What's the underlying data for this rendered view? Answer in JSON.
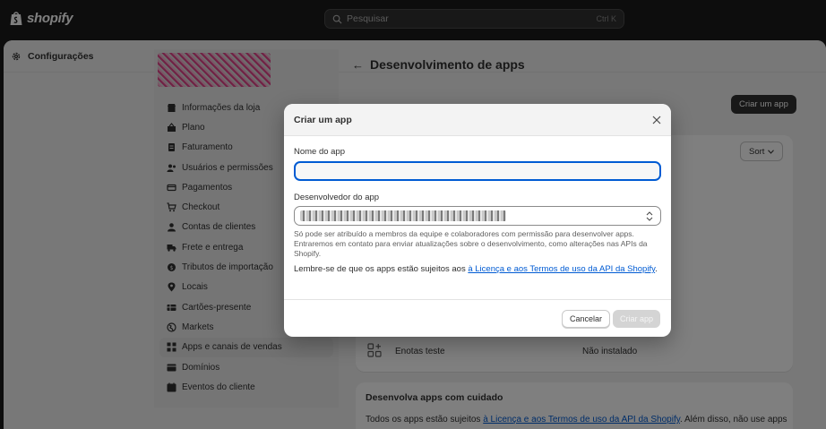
{
  "topbar": {
    "logo_text": "shopify",
    "search_placeholder": "Pesquisar",
    "search_shortcut": "Ctrl K"
  },
  "settings": {
    "title": "Configurações"
  },
  "sidebar": {
    "items": [
      {
        "label": "Informações da loja",
        "icon": "store-icon"
      },
      {
        "label": "Plano",
        "icon": "plan-icon"
      },
      {
        "label": "Faturamento",
        "icon": "billing-icon"
      },
      {
        "label": "Usuários e permissões",
        "icon": "users-icon"
      },
      {
        "label": "Pagamentos",
        "icon": "payments-icon"
      },
      {
        "label": "Checkout",
        "icon": "cart-icon"
      },
      {
        "label": "Contas de clientes",
        "icon": "customer-icon"
      },
      {
        "label": "Frete e entrega",
        "icon": "truck-icon"
      },
      {
        "label": "Tributos de importação",
        "icon": "duties-icon"
      },
      {
        "label": "Locais",
        "icon": "location-icon"
      },
      {
        "label": "Cartões-presente",
        "icon": "gift-card-icon"
      },
      {
        "label": "Markets",
        "icon": "globe-icon"
      },
      {
        "label": "Apps e canais de vendas",
        "icon": "apps-icon"
      },
      {
        "label": "Domínios",
        "icon": "domain-icon"
      },
      {
        "label": "Eventos do cliente",
        "icon": "events-icon"
      }
    ],
    "active_index": 12
  },
  "main": {
    "page_title": "Desenvolvimento de apps",
    "create_button": "Criar um app",
    "sort_button": "Sort",
    "app_row": {
      "name": "Enotas teste",
      "status": "Não instalado"
    },
    "careful_card": {
      "title": "Desenvolva apps com cuidado",
      "text_before": "Todos os apps estão sujeitos ",
      "link": "à Licença e aos Termos de uso da API da Shopify",
      "text_after": ". Além disso, não use apps"
    }
  },
  "modal": {
    "title": "Criar um app",
    "name_label": "Nome do app",
    "name_value": "",
    "developer_label": "Desenvolvedor do app",
    "help_text": "Só pode ser atribuído a membros da equipe e colaboradores com permissão para desenvolver apps. Entraremos em contato para enviar atualizações sobre o desenvolvimento, como alterações nas APIs da Shopify.",
    "license_before": "Lembre-se de que os apps estão sujeitos aos ",
    "license_link": "à Licença e aos Termos de uso da API da Shopify",
    "license_after": ".",
    "cancel_label": "Cancelar",
    "submit_label": "Criar app"
  },
  "colors": {
    "topbar": "#1a1a1a",
    "primary_button": "#303030",
    "link": "#005bd3",
    "focus": "#005bd3",
    "disabled_button": "#d4d4d4"
  }
}
